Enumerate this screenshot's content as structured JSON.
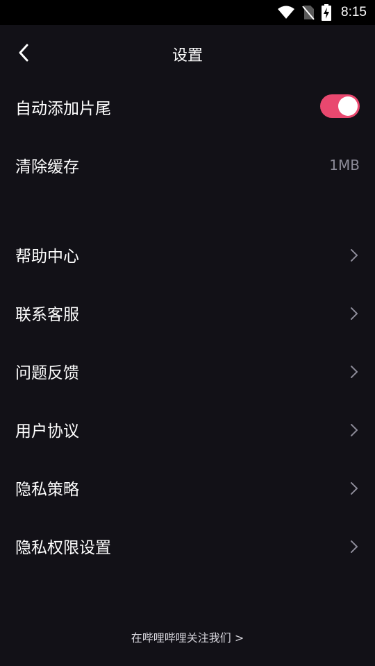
{
  "status_bar": {
    "time": "8:15",
    "icons": [
      "wifi-icon",
      "no-sim-icon",
      "battery-charging-icon"
    ]
  },
  "header": {
    "title": "设置",
    "back_icon": "chevron-left-icon"
  },
  "settings": {
    "auto_ending": {
      "label": "自动添加片尾",
      "enabled": true
    },
    "clear_cache": {
      "label": "清除缓存",
      "value": "1MB"
    }
  },
  "menu": {
    "items": [
      {
        "label": "帮助中心",
        "icon": "chevron-right-icon"
      },
      {
        "label": "联系客服",
        "icon": "chevron-right-icon"
      },
      {
        "label": "问题反馈",
        "icon": "chevron-right-icon"
      },
      {
        "label": "用户协议",
        "icon": "chevron-right-icon"
      },
      {
        "label": "隐私策略",
        "icon": "chevron-right-icon"
      },
      {
        "label": "隐私权限设置",
        "icon": "chevron-right-icon"
      }
    ]
  },
  "footer": {
    "link_text": "在哔哩哔哩关注我们 >"
  },
  "colors": {
    "background": "#121117",
    "accent": "#e9486f",
    "secondary_text": "#8d8c99"
  }
}
